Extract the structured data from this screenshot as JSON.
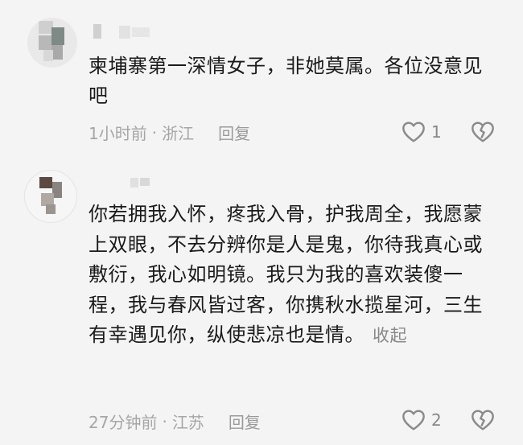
{
  "comments": [
    {
      "text": "柬埔寨第一深情女子，非她莫属。各位没意见吧",
      "time": "1小时前",
      "location": "浙江",
      "reply_label": "回复",
      "like_count": "1"
    },
    {
      "text": "你若拥我入怀，疼我入骨，护我周全，我愿蒙上双眼，不去分辨你是人是鬼，你待我真心或敷衍，我心如明镜。我只为我的喜欢装傻一程，我与春风皆过客，你携秋水揽星河，三生有幸遇见你，纵使悲凉也是情。",
      "collapse_label": "收起",
      "time": "27分钟前",
      "location": "江苏",
      "reply_label": "回复",
      "like_count": "2"
    }
  ],
  "meta_separator": "·",
  "icons": {
    "like": "heart-icon",
    "dislike": "broken-heart-icon"
  }
}
